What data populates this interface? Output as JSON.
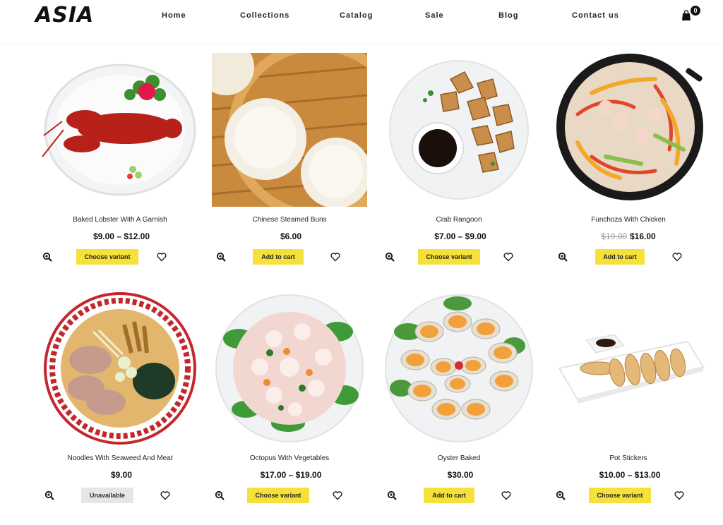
{
  "header": {
    "logo": "ASIA",
    "nav": [
      "Home",
      "Collections",
      "Catalog",
      "Sale",
      "Blog",
      "Contact us"
    ],
    "active_nav": "Home",
    "cart_count": "0"
  },
  "colors": {
    "accent": "#f6e13a",
    "disabled": "#e6e6e6",
    "text": "#111111"
  },
  "products": [
    {
      "title": "Baked Lobster With A Garnish",
      "price": "$9.00 – $12.00",
      "old_price": "",
      "button": "Choose variant",
      "image": "lobster-plate"
    },
    {
      "title": "Chinese Steamed Buns",
      "price": "$6.00",
      "old_price": "",
      "button": "Add to cart",
      "image": "steamed-buns-basket"
    },
    {
      "title": "Crab Rangoon",
      "price": "$7.00 – $9.00",
      "old_price": "",
      "button": "Choose variant",
      "image": "crab-rangoon-plate"
    },
    {
      "title": "Funchoza With Chicken",
      "price": "$16.00",
      "old_price": "$19.00",
      "button": "Add to cart",
      "image": "funchoza-pan"
    },
    {
      "title": "Noodles With Seaweed And Meat",
      "price": "$9.00",
      "old_price": "",
      "button": "Unavailable",
      "image": "ramen-bowl"
    },
    {
      "title": "Octopus With Vegetables",
      "price": "$17.00 – $19.00",
      "old_price": "",
      "button": "Choose variant",
      "image": "octopus-plate"
    },
    {
      "title": "Oyster Baked",
      "price": "$30.00",
      "old_price": "",
      "button": "Add to cart",
      "image": "oysters-plate"
    },
    {
      "title": "Pot Stickers",
      "price": "$10.00 – $13.00",
      "old_price": "",
      "button": "Choose variant",
      "image": "pot-stickers-dish"
    }
  ]
}
